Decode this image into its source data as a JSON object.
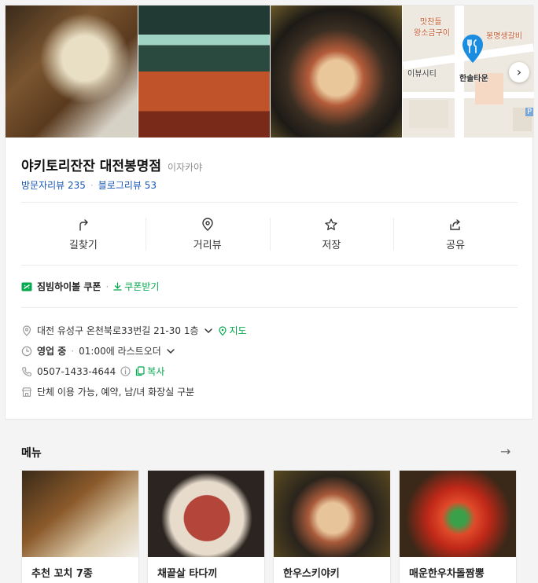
{
  "map": {
    "labels": {
      "market": "맛찬들",
      "market_sub": "왕소금구이",
      "restaurant": "봉명생갈비",
      "left_poi": "이뷰시티",
      "pin_label": "한솔타운",
      "p_marker": "P"
    },
    "next_icon": "chevron-right-icon"
  },
  "place": {
    "name": "야키토리잔잔 대전봉명점",
    "category": "이자카야",
    "visitor_reviews": "방문자리뷰 235",
    "blog_reviews": "블로그리뷰 53",
    "review_sep": "·"
  },
  "actions": [
    {
      "label": "길찾기",
      "icon": "directions-icon"
    },
    {
      "label": "거리뷰",
      "icon": "location-pin-icon"
    },
    {
      "label": "저장",
      "icon": "star-icon"
    },
    {
      "label": "공유",
      "icon": "share-icon"
    }
  ],
  "coupon": {
    "name": "짐빔하이볼 쿠폰",
    "sep": "·",
    "get_label": "쿠폰받기"
  },
  "info": {
    "address": "대전 유성구 온천북로33번길 21-30 1층",
    "map_link": "지도",
    "status": "영업 중",
    "status_sep": "·",
    "hours": "01:00에 라스트오더",
    "phone": "0507-1433-4644",
    "copy_label": "복사",
    "amenities": "단체 이용 가능, 예약, 남/녀 화장실 구분"
  },
  "menu": {
    "title": "메뉴",
    "items": [
      {
        "name": "추천 꼬치 7종"
      },
      {
        "name": "채끝살 타다끼"
      },
      {
        "name": "한우스키야키"
      },
      {
        "name": "매운한우차돌짬뽕"
      }
    ]
  },
  "colors": {
    "green": "#03a94d",
    "blue_link": "#1a57b5",
    "pin": "#1b8de0"
  }
}
